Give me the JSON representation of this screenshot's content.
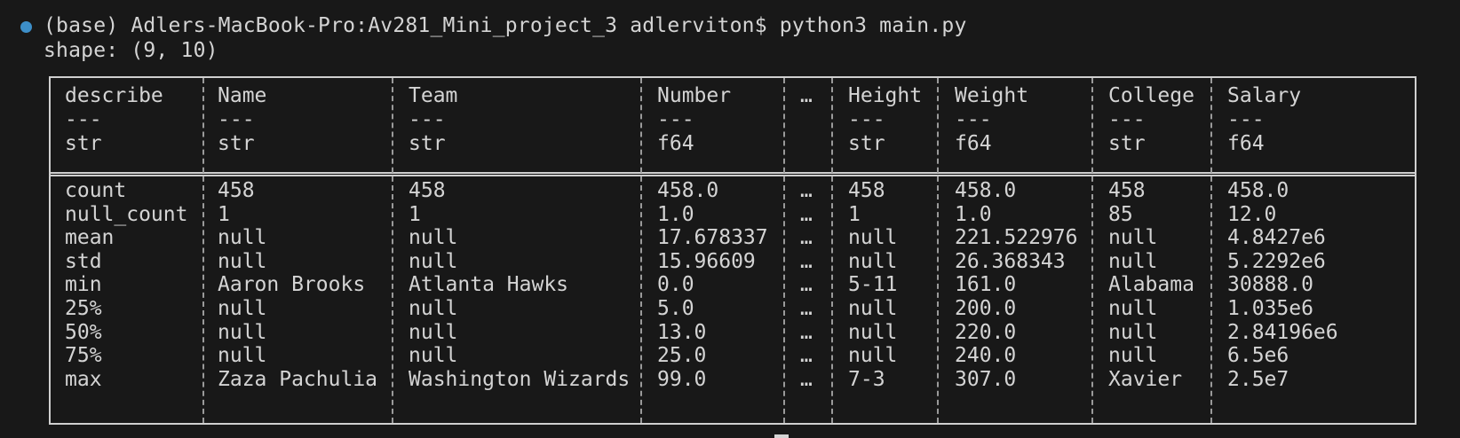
{
  "terminal": {
    "prompt": "(base) Adlers-MacBook-Pro:Av281_Mini_project_3 adlerviton$ python3 main.py",
    "shape_line": "shape: (9, 10)"
  },
  "table": {
    "columns": [
      {
        "name": "describe",
        "sep": "---",
        "dtype": "str"
      },
      {
        "name": "Name",
        "sep": "---",
        "dtype": "str"
      },
      {
        "name": "Team",
        "sep": "---",
        "dtype": "str"
      },
      {
        "name": "Number",
        "sep": "---",
        "dtype": "f64"
      },
      {
        "name": "…",
        "sep": "",
        "dtype": ""
      },
      {
        "name": "Height",
        "sep": "---",
        "dtype": "str"
      },
      {
        "name": "Weight",
        "sep": "---",
        "dtype": "f64"
      },
      {
        "name": "College",
        "sep": "---",
        "dtype": "str"
      },
      {
        "name": "Salary",
        "sep": "---",
        "dtype": "f64"
      }
    ],
    "rows": [
      [
        "count",
        "458",
        "458",
        "458.0",
        "…",
        "458",
        "458.0",
        "458",
        "458.0"
      ],
      [
        "null_count",
        "1",
        "1",
        "1.0",
        "…",
        "1",
        "1.0",
        "85",
        "12.0"
      ],
      [
        "mean",
        "null",
        "null",
        "17.678337",
        "…",
        "null",
        "221.522976",
        "null",
        "4.8427e6"
      ],
      [
        "std",
        "null",
        "null",
        "15.96609",
        "…",
        "null",
        "26.368343",
        "null",
        "5.2292e6"
      ],
      [
        "min",
        "Aaron Brooks",
        "Atlanta Hawks",
        "0.0",
        "…",
        "5-11",
        "161.0",
        "Alabama",
        "30888.0"
      ],
      [
        "25%",
        "null",
        "null",
        "5.0",
        "…",
        "null",
        "200.0",
        "null",
        "1.035e6"
      ],
      [
        "50%",
        "null",
        "null",
        "13.0",
        "…",
        "null",
        "220.0",
        "null",
        "2.84196e6"
      ],
      [
        "75%",
        "null",
        "null",
        "25.0",
        "…",
        "null",
        "240.0",
        "null",
        "6.5e6"
      ],
      [
        "max",
        "Zaza Pachulia",
        "Washington Wizards",
        "99.0",
        "…",
        "7-3",
        "307.0",
        "Xavier",
        "2.5e7"
      ]
    ]
  }
}
